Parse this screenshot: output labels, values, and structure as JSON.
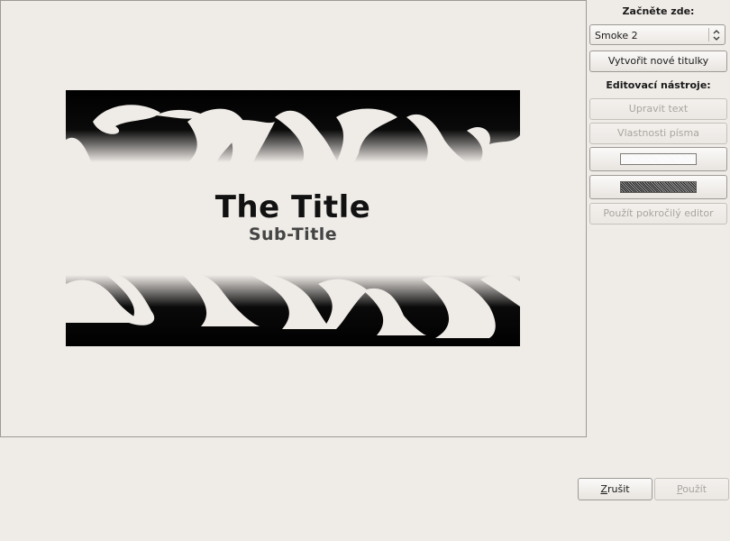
{
  "preview": {
    "title": "The Title",
    "subtitle": "Sub-Title"
  },
  "panel": {
    "start_label": "Začněte zde:",
    "template_combo_value": "Smoke 2",
    "create_button": "Vytvořit nové titulky",
    "editing_tools_label": "Editovací nástroje:",
    "edit_text_button": "Upravit text",
    "font_properties_button": "Vlastnosti písma",
    "advanced_editor_button": "Použít pokročilý editor"
  },
  "footer": {
    "cancel_mnemonic": "Z",
    "cancel_rest": "rušit",
    "apply_mnemonic": "P",
    "apply_rest": "oužít"
  },
  "colors": {
    "background": "#efebe7",
    "smoke": "#000000"
  }
}
